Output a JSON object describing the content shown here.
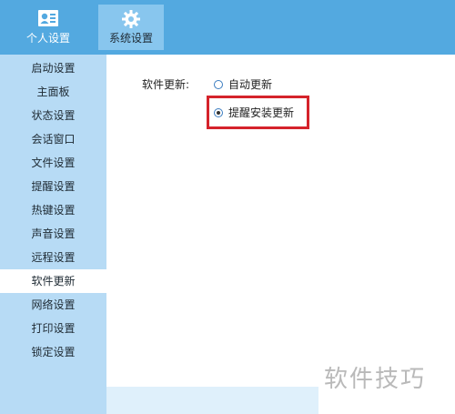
{
  "tabs": [
    {
      "label": "个人设置",
      "icon": "id-card-icon",
      "active": false
    },
    {
      "label": "系统设置",
      "icon": "gear-icon",
      "active": true
    }
  ],
  "sidebar": {
    "items": [
      {
        "label": "启动设置"
      },
      {
        "label": "主面板"
      },
      {
        "label": "状态设置"
      },
      {
        "label": "会话窗口"
      },
      {
        "label": "文件设置"
      },
      {
        "label": "提醒设置"
      },
      {
        "label": "热键设置"
      },
      {
        "label": "声音设置"
      },
      {
        "label": "远程设置"
      },
      {
        "label": "软件更新",
        "active": true
      },
      {
        "label": "网络设置"
      },
      {
        "label": "打印设置"
      },
      {
        "label": "锁定设置"
      }
    ]
  },
  "main": {
    "field_label": "软件更新:",
    "options": [
      {
        "label": "自动更新",
        "checked": false
      },
      {
        "label": "提醒安装更新",
        "checked": true
      }
    ]
  },
  "watermark": "软件技巧",
  "colors": {
    "topbar": "#53a9e0",
    "sidebar": "#b7dbf5",
    "highlight": "#d5232b"
  }
}
